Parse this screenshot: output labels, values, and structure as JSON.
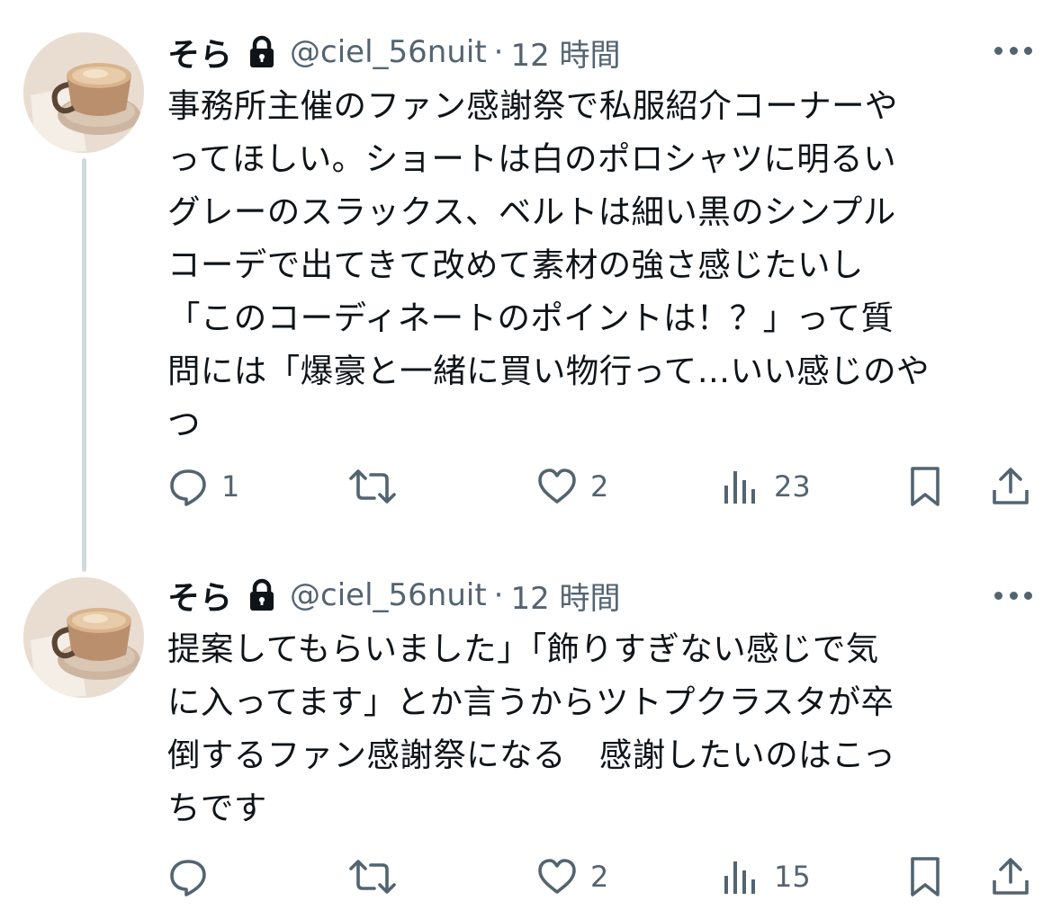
{
  "tweets": [
    {
      "display_name": "そら",
      "handle": "@ciel_56nuit",
      "separator": "·",
      "time": "12 時間",
      "lines": [
        "事務所主催のファン感謝祭で私服紹介コーナーや",
        "ってほしい。ショートは白のポロシャツに明るい",
        "グレーのスラックス、ベルトは細い黒のシンプル",
        "コーデで出てきて改めて素材の強さ感じたいし",
        "「このコーディネートのポイントは！？」って質",
        "問には「爆豪と一緒に買い物行って…いい感じのや",
        "つ"
      ],
      "reply_count": "1",
      "retweet_count": "",
      "like_count": "2",
      "view_count": "23"
    },
    {
      "display_name": "そら",
      "handle": "@ciel_56nuit",
      "separator": "·",
      "time": "12 時間",
      "lines": [
        "提案してもらいました」「飾りすぎない感じで気",
        "に入ってます」とか言うからツトプクラスタが卒",
        "倒するファン感謝祭になる　感謝したいのはこっ",
        "ちです"
      ],
      "reply_count": "",
      "retweet_count": "",
      "like_count": "2",
      "view_count": "15"
    }
  ],
  "icons": {
    "lock": "lock-icon",
    "more": "more-icon",
    "reply": "reply-icon",
    "retweet": "retweet-icon",
    "like": "like-icon",
    "views": "views-icon",
    "bookmark": "bookmark-icon",
    "share": "share-icon"
  },
  "colors": {
    "text": "#0f1419",
    "secondary": "#536471",
    "thread_line": "#cfd9de",
    "background": "#ffffff"
  }
}
